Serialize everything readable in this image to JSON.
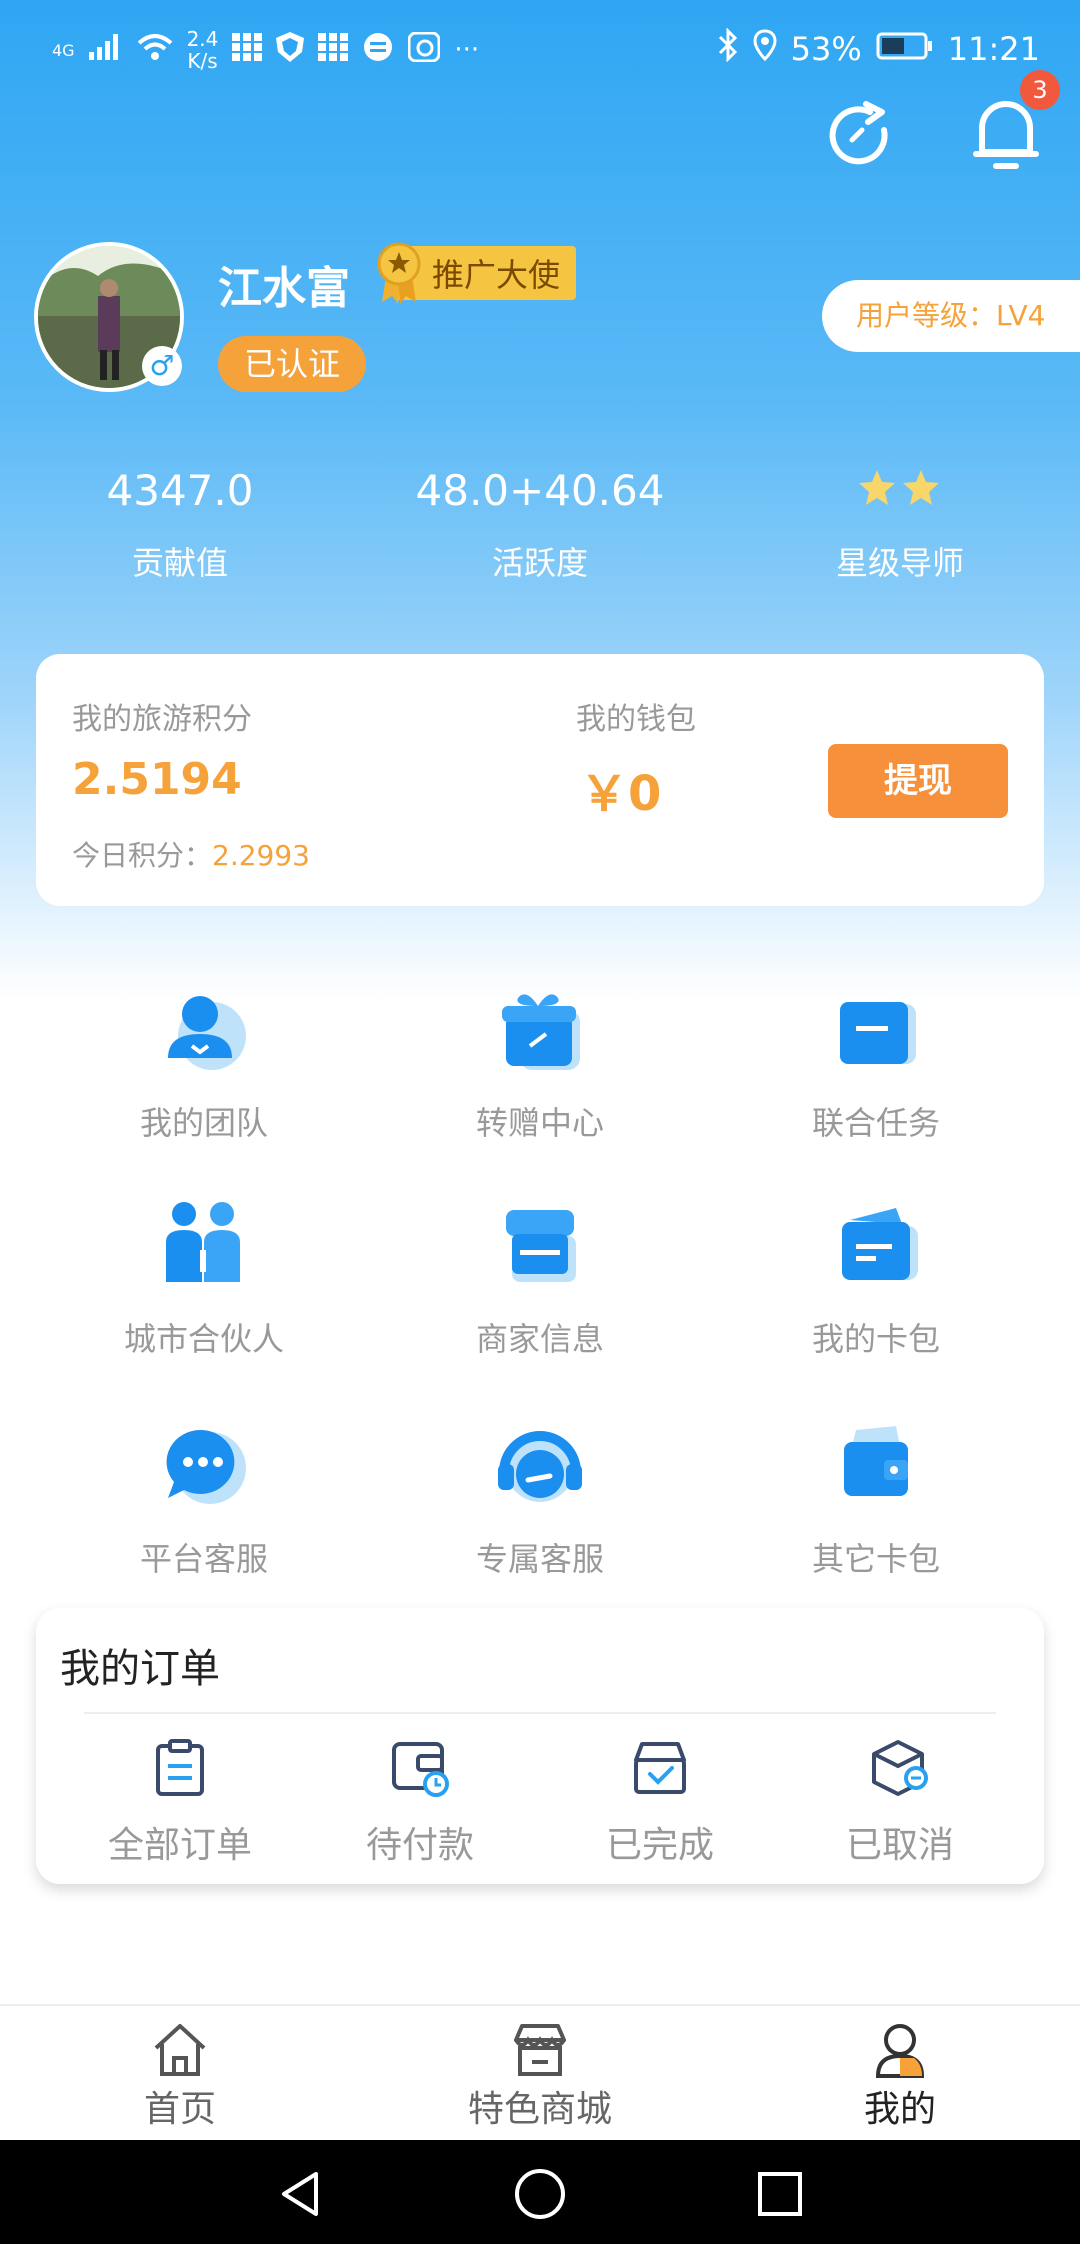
{
  "status_bar": {
    "network": "4G",
    "speed_value": "2.4",
    "speed_unit": "K/s",
    "battery": "53%",
    "time": "11:21"
  },
  "header": {
    "notification_count": "3"
  },
  "profile": {
    "name": "江水富",
    "ambassador_badge": "推广大使",
    "verified_label": "已认证",
    "user_level": "用户等级：LV4",
    "gender_symbol": "♂"
  },
  "stats": [
    {
      "value": "4347.0",
      "label": "贡献值"
    },
    {
      "value": "48.0+40.64",
      "label": "活跃度"
    },
    {
      "value": "",
      "label": "星级导师",
      "stars": 2
    }
  ],
  "points_card": {
    "travel_points_title": "我的旅游积分",
    "travel_points_value": "2.5194",
    "today_label": "今日积分：",
    "today_value": "2.2993",
    "wallet_title": "我的钱包",
    "wallet_value": "￥0",
    "withdraw_label": "提现"
  },
  "features": [
    {
      "label": "我的团队",
      "icon": "team-icon"
    },
    {
      "label": "转赠中心",
      "icon": "gift-icon"
    },
    {
      "label": "联合任务",
      "icon": "folder-icon"
    },
    {
      "label": "城市合伙人",
      "icon": "partners-icon"
    },
    {
      "label": "商家信息",
      "icon": "store-icon"
    },
    {
      "label": "我的卡包",
      "icon": "card-wallet-icon"
    },
    {
      "label": "平台客服",
      "icon": "chat-icon"
    },
    {
      "label": "专属客服",
      "icon": "headset-icon"
    },
    {
      "label": "其它卡包",
      "icon": "wallet-icon"
    }
  ],
  "orders": {
    "title": "我的订单",
    "items": [
      {
        "label": "全部订单",
        "icon": "clipboard-icon"
      },
      {
        "label": "待付款",
        "icon": "wallet-clock-icon"
      },
      {
        "label": "已完成",
        "icon": "box-check-icon"
      },
      {
        "label": "已取消",
        "icon": "box-cancel-icon"
      }
    ]
  },
  "tabbar": [
    {
      "label": "首页",
      "icon": "home-icon"
    },
    {
      "label": "特色商城",
      "icon": "shop-icon"
    },
    {
      "label": "我的",
      "icon": "user-icon"
    }
  ],
  "colors": {
    "accent_orange": "#f6a23a",
    "primary_blue": "#2fa6f3"
  }
}
